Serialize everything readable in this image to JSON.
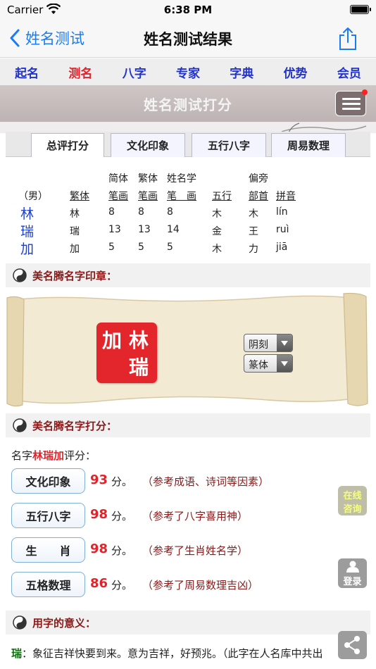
{
  "status": {
    "carrier": "Carrier",
    "time": "6:38 PM"
  },
  "nav": {
    "back_label": "姓名测试",
    "title": "姓名测试结果"
  },
  "menu": [
    {
      "label": "起名",
      "active": false
    },
    {
      "label": "测名",
      "active": true
    },
    {
      "label": "八字",
      "active": false
    },
    {
      "label": "专家",
      "active": false
    },
    {
      "label": "字典",
      "active": false
    },
    {
      "label": "优势",
      "active": false
    },
    {
      "label": "会员",
      "active": false
    }
  ],
  "banner": {
    "title": "姓名测试打分"
  },
  "tabs": [
    {
      "label": "总评打分",
      "active": true
    },
    {
      "label": "文化印象",
      "active": false
    },
    {
      "label": "五行八字",
      "active": false
    },
    {
      "label": "周易数理",
      "active": false
    }
  ],
  "info": {
    "gender": "（男）",
    "headers_top": [
      "简体",
      "繁体",
      "姓名学",
      "偏旁"
    ],
    "headers": [
      "繁体",
      "笔画",
      "笔画",
      "笔　画",
      "五行",
      "部首",
      "拼音"
    ],
    "rows": [
      {
        "char": "林",
        "trad": "林",
        "simp": "8",
        "tradStroke": "8",
        "nameStroke": "8",
        "wuxing": "木",
        "radical": "木",
        "pinyin": "lín"
      },
      {
        "char": "瑞",
        "trad": "瑞",
        "simp": "13",
        "tradStroke": "13",
        "nameStroke": "14",
        "wuxing": "金",
        "radical": "王",
        "pinyin": "ruì"
      },
      {
        "char": "加",
        "trad": "加",
        "simp": "5",
        "tradStroke": "5",
        "nameStroke": "5",
        "wuxing": "木",
        "radical": "力",
        "pinyin": "jiā"
      }
    ]
  },
  "sections": {
    "seal": "美名腾名字印章：",
    "score": "美名腾名字打分：",
    "meaning": "用字的意义："
  },
  "seal": {
    "chars": [
      "林",
      "瑞",
      "加"
    ],
    "style_select": "阴刻",
    "font_select": "篆体"
  },
  "scores": {
    "prefix": "名字",
    "name": "林瑞加",
    "suffix": "评分：",
    "unit": "分。",
    "items": [
      {
        "label": "文化印象",
        "value": "93",
        "note": "（参考成语、诗词等因素）"
      },
      {
        "label": "五行八字",
        "value": "98",
        "note": "（参考了八字喜用神）"
      },
      {
        "label": "生　　肖",
        "value": "98",
        "note": "（参考了生肖姓名学）"
      },
      {
        "label": "五格数理",
        "value": "86",
        "note": "（参考了周易数理吉凶）"
      }
    ]
  },
  "float": {
    "consult_line1": "在线",
    "consult_line2": "咨询",
    "login": "登录"
  },
  "meaning": {
    "char": "瑞",
    "text": "：象征吉祥快要到来。意为吉祥，好预兆。（此字在人名库中共出"
  }
}
